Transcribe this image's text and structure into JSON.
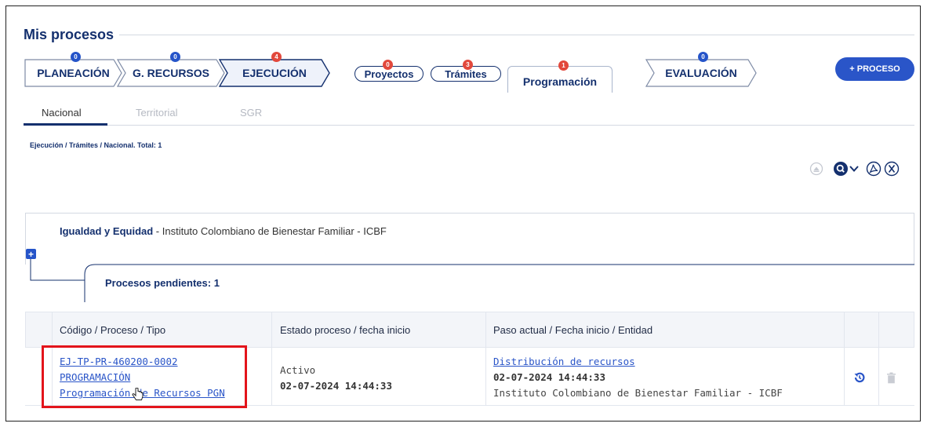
{
  "page_title": "Mis procesos",
  "stages": [
    {
      "label": "PLANEACIÓN",
      "count": "0"
    },
    {
      "label": "G. RECURSOS",
      "count": "0"
    },
    {
      "label": "EJECUCIÓN",
      "count": "4"
    },
    {
      "label": "EVALUACIÓN",
      "count": "0"
    }
  ],
  "sub_stages": [
    {
      "label": "Proyectos",
      "count": "0"
    },
    {
      "label": "Trámites",
      "count": "3"
    },
    {
      "label": "Programación",
      "count": "1"
    }
  ],
  "add_process_label": "+ PROCESO",
  "tabs": [
    "Nacional",
    "Territorial",
    "SGR"
  ],
  "breadcrumb": "Ejecución / Trámites / Nacional. Total: 1",
  "group": {
    "sector": "Igualdad y Equidad",
    "entity": " - Instituto Colombiano de Bienestar Familiar - ICBF",
    "pending": "Procesos pendientes: 1"
  },
  "table": {
    "headers": [
      "Código / Proceso / Tipo",
      "Estado proceso / fecha inicio",
      "Paso actual / Fecha inicio / Entidad"
    ],
    "rows": [
      {
        "code": "EJ-TP-PR-460200-0002",
        "process": "PROGRAMACIÓN",
        "type": "Programación de Recursos PGN",
        "status": "Activo",
        "status_date": "02-07-2024 14:44:33",
        "step": "Distribución de recursos",
        "step_date": "02-07-2024 14:44:33",
        "step_entity": "Instituto Colombiano de Bienestar Familiar - ICBF"
      }
    ]
  },
  "colors": {
    "primary": "#14306e",
    "accent": "#2554c9",
    "badge_red": "#e2483c",
    "highlight": "#e3141b"
  }
}
